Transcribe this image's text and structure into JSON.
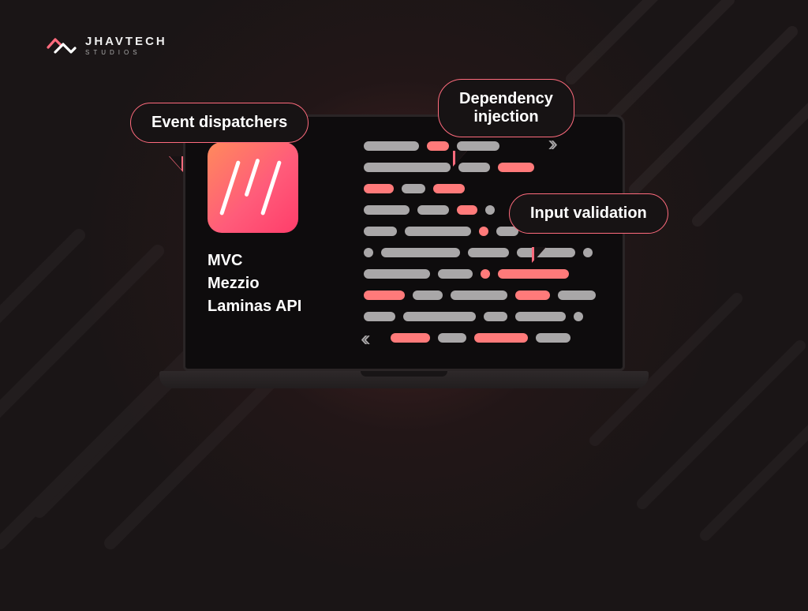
{
  "brand": {
    "name": "JHAVTECH",
    "subtitle": "STUDIOS"
  },
  "bubbles": {
    "event_dispatchers": "Event dispatchers",
    "dependency_injection_l1": "Dependency",
    "dependency_injection_l2": "injection",
    "input_validation": "Input validation"
  },
  "features": {
    "mvc": "MVC",
    "mezzio": "Mezzio",
    "laminas": "Laminas API"
  },
  "colors": {
    "accent": "#ff6b7d",
    "gradient_start": "#ff8a5c",
    "gradient_end": "#ff3d6a",
    "bg": "#1a1516"
  }
}
